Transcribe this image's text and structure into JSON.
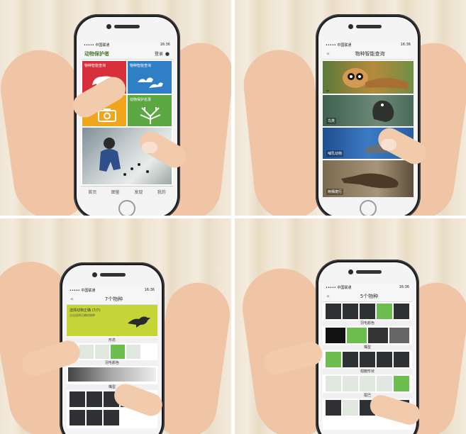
{
  "screens": {
    "home": {
      "status_left": "••••• 中国联通",
      "status_time": "16:36",
      "app_title": "动物保护者",
      "login_label": "登录",
      "tiles": [
        {
          "label": "物种智能查询",
          "color": "#d7303c",
          "icon": "bear-icon"
        },
        {
          "label": "物种智能查询",
          "color": "#2f7fc7",
          "icon": "birds-icon"
        },
        {
          "label": "",
          "color": "#f0a51c",
          "icon": "camera-icon"
        },
        {
          "label": "动物保护名录",
          "color": "#5ba742",
          "icon": "coral-icon"
        }
      ],
      "tabs": [
        "首页",
        "图鉴",
        "发现",
        "我的",
        ""
      ]
    },
    "species": {
      "status_left": "••••• 中国联通",
      "status_time": "16:36",
      "title": "物种智能查询",
      "rows": [
        {
          "label": "",
          "color": "#c47b2a"
        },
        {
          "label": "鸟类",
          "color": "#4b6a5b"
        },
        {
          "label": "哺乳动物",
          "color": "#2f6fb0"
        },
        {
          "label": "两栖爬行",
          "color": "#6d5a3e"
        }
      ]
    },
    "quiz": {
      "status_left": "••••• 中国联通",
      "status_time": "16:36",
      "title": "7个物种",
      "banner_title": "选择动物正确 (7/7)",
      "banner_sub": "点击选择正确的物种",
      "section_1": "形态",
      "section_2": "羽毛颜色",
      "section_3": "嘴型"
    },
    "result": {
      "status_left": "••••• 中国联通",
      "status_time": "16:36",
      "title": "5个物种",
      "section_1": "羽毛颜色",
      "section_2": "嘴型",
      "section_3": "翅膀形状",
      "section_4": "尾巴"
    }
  },
  "colors": {
    "leaf_green": "#c5d437",
    "accent_green": "#6cbf4e",
    "phone_black": "#1b1b1d",
    "skin": "#efc5a6"
  }
}
